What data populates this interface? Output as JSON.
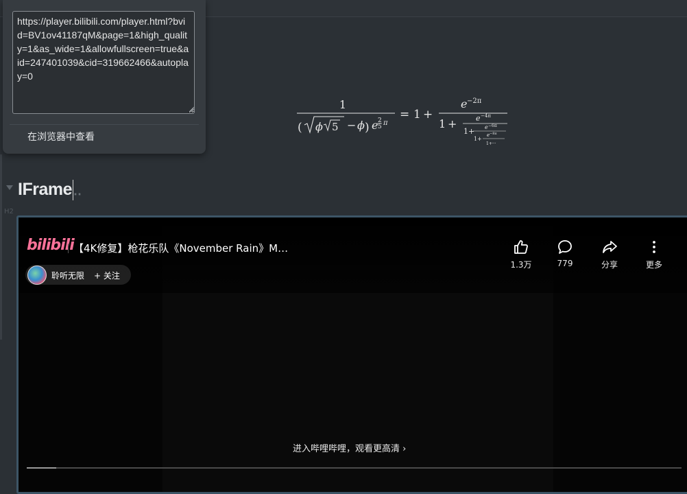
{
  "popup": {
    "url": "https://player.bilibili.com/player.html?bvid=BV1ov41187qM&page=1&high_quality=1&as_wide=1&allowfullscreen=true&aid=247401039&cid=319662466&autoplay=0",
    "open_in_browser_label": "在浏览器中查看"
  },
  "heading": {
    "text": "IFrame",
    "level_tag": "H2"
  },
  "formula": {
    "latex": "\\frac{1}{\\Bigl(\\sqrt{\\phi \\sqrt{5}}-\\phi\\Bigr) e^{\\frac25 \\pi}} = 1+\\frac{e^{-2\\pi}} {1+\\frac{e^{-4\\pi}} {1+\\frac{e^{-6\\pi}} {1+\\frac{e^{-8\\pi}} {1+\\cdots} } } }",
    "lhs_num": "1",
    "rhs_one": "1",
    "plus": "+",
    "eq": "=",
    "e1_exp": "−2π",
    "e2_exp": "−4π",
    "e3_exp": "−6π",
    "e4_exp": "−8π",
    "tail": "1+···"
  },
  "player": {
    "logo": "bilibili",
    "title": "【4K修复】枪花乐队《November Rain》M…",
    "author": "聆听无限",
    "follow_label": "+ 关注",
    "actions": [
      {
        "icon": "thumbs-up-icon",
        "label": "1.3万"
      },
      {
        "icon": "comment-icon",
        "label": "779"
      },
      {
        "icon": "share-icon",
        "label": "分享"
      },
      {
        "icon": "more-icon",
        "label": "更多"
      }
    ],
    "open_app_label": "进入哔哩哔哩，观看更高清",
    "progress": 0.045
  }
}
